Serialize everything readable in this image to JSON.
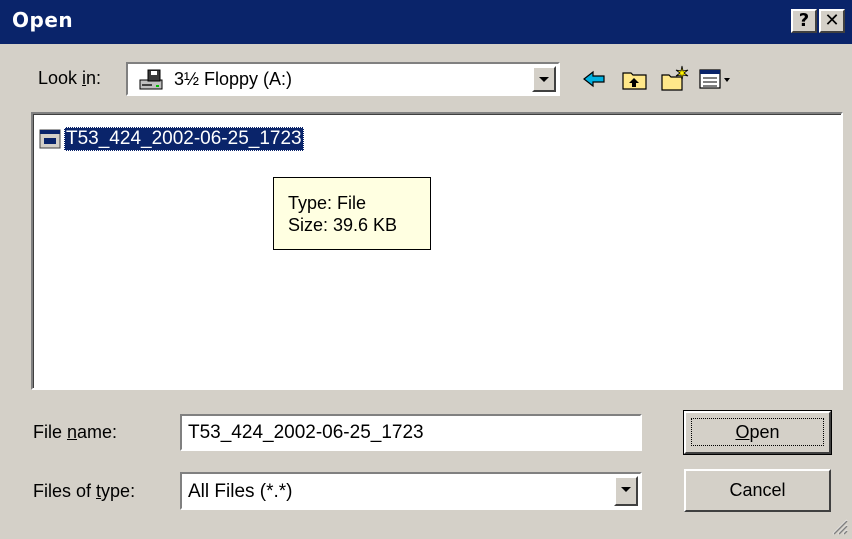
{
  "window": {
    "title": "Open",
    "help_label": "?",
    "close_label": "✕"
  },
  "look_in": {
    "label_prefix": "Look ",
    "label_accel": "i",
    "label_suffix": "n:",
    "value": "3½ Floppy (A:)",
    "icon": "floppy-drive-icon"
  },
  "toolbar": {
    "buttons": [
      "back-icon",
      "up-folder-icon",
      "new-folder-icon",
      "view-menu-icon"
    ]
  },
  "file_list": {
    "items": [
      {
        "name": "T53_424_2002-06-25_1723",
        "icon": "file-icon",
        "selected": true
      }
    ]
  },
  "tooltip": {
    "type_line": "Type: File",
    "size_line": "Size: 39.6 KB"
  },
  "file_name": {
    "label_prefix": "File ",
    "label_accel": "n",
    "label_suffix": "ame:",
    "value": "T53_424_2002-06-25_1723"
  },
  "files_of_type": {
    "label_prefix": "Files of ",
    "label_accel": "t",
    "label_suffix": "ype:",
    "value": "All Files (*.*)"
  },
  "buttons": {
    "open_accel": "O",
    "open_rest": "pen",
    "cancel": "Cancel"
  },
  "colors": {
    "titlebar": "#0a246a",
    "face": "#d4d0c8",
    "selection": "#0a246a",
    "tooltip_bg": "#ffffe1"
  }
}
